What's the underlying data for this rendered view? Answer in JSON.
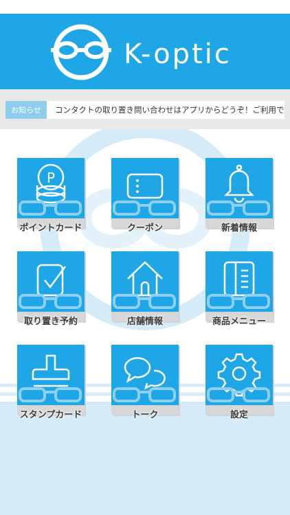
{
  "header": {
    "brand": "K-optic",
    "background_color": "#1ea6e6",
    "logo_icon": "goggle-face-logo"
  },
  "news": {
    "badge": "お知らせ",
    "text": "コンタクトの取り置き問い合わせはアプリからどうぞ！ご利用で貯まるポ"
  },
  "menu": {
    "items": [
      {
        "label": "ポイントカード",
        "icon": "coin-stack-icon"
      },
      {
        "label": "クーポン",
        "icon": "coupon-icon"
      },
      {
        "label": "新着情報",
        "icon": "bell-icon"
      },
      {
        "label": "取り置き予約",
        "icon": "checkbox-icon"
      },
      {
        "label": "店舗情報",
        "icon": "house-icon"
      },
      {
        "label": "商品メニュー",
        "icon": "book-icon"
      },
      {
        "label": "スタンプカード",
        "icon": "stamp-icon"
      },
      {
        "label": "トーク",
        "icon": "chat-bubbles-icon"
      },
      {
        "label": "設定",
        "icon": "gear-icon"
      }
    ]
  },
  "colors": {
    "accent": "#1ea6e6",
    "badge": "#8fcdec",
    "bottom_band": "#d5ebf9"
  }
}
